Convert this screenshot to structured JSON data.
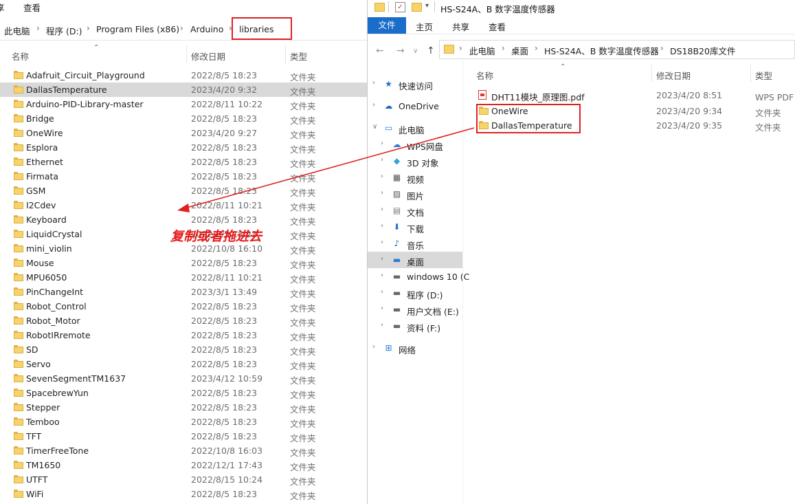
{
  "left": {
    "ribbon_tabs": [
      "享",
      "查看"
    ],
    "breadcrumb": [
      "此电脑",
      "程序 (D:)",
      "Program Files (x86)",
      "Arduino",
      "libraries"
    ],
    "columns": {
      "name": "名称",
      "date": "修改日期",
      "type": "类型"
    },
    "rows": [
      {
        "name": "Adafruit_Circuit_Playground",
        "date": "2022/8/5 18:23",
        "type": "文件夹"
      },
      {
        "name": "DallasTemperature",
        "date": "2023/4/20 9:32",
        "type": "文件夹"
      },
      {
        "name": "Arduino-PID-Library-master",
        "date": "2022/8/11 10:22",
        "type": "文件夹"
      },
      {
        "name": "Bridge",
        "date": "2022/8/5 18:23",
        "type": "文件夹"
      },
      {
        "name": "OneWire",
        "date": "2023/4/20 9:27",
        "type": "文件夹"
      },
      {
        "name": "Esplora",
        "date": "2022/8/5 18:23",
        "type": "文件夹"
      },
      {
        "name": "Ethernet",
        "date": "2022/8/5 18:23",
        "type": "文件夹"
      },
      {
        "name": "Firmata",
        "date": "2022/8/5 18:23",
        "type": "文件夹"
      },
      {
        "name": "GSM",
        "date": "2022/8/5 18:23",
        "type": "文件夹"
      },
      {
        "name": "I2Cdev",
        "date": "2022/8/11 10:21",
        "type": "文件夹"
      },
      {
        "name": "Keyboard",
        "date": "2022/8/5 18:23",
        "type": "文件夹"
      },
      {
        "name": "LiquidCrystal",
        "date": "2022/8/5 18:23",
        "type": "文件夹"
      },
      {
        "name": "mini_violin",
        "date": "2022/10/8 16:10",
        "type": "文件夹"
      },
      {
        "name": "Mouse",
        "date": "2022/8/5 18:23",
        "type": "文件夹"
      },
      {
        "name": "MPU6050",
        "date": "2022/8/11 10:21",
        "type": "文件夹"
      },
      {
        "name": "PinChangeInt",
        "date": "2023/3/1 13:49",
        "type": "文件夹"
      },
      {
        "name": "Robot_Control",
        "date": "2022/8/5 18:23",
        "type": "文件夹"
      },
      {
        "name": "Robot_Motor",
        "date": "2022/8/5 18:23",
        "type": "文件夹"
      },
      {
        "name": "RobotIRremote",
        "date": "2022/8/5 18:23",
        "type": "文件夹"
      },
      {
        "name": "SD",
        "date": "2022/8/5 18:23",
        "type": "文件夹"
      },
      {
        "name": "Servo",
        "date": "2022/8/5 18:23",
        "type": "文件夹"
      },
      {
        "name": "SevenSegmentTM1637",
        "date": "2023/4/12 10:59",
        "type": "文件夹"
      },
      {
        "name": "SpacebrewYun",
        "date": "2022/8/5 18:23",
        "type": "文件夹"
      },
      {
        "name": "Stepper",
        "date": "2022/8/5 18:23",
        "type": "文件夹"
      },
      {
        "name": "Temboo",
        "date": "2022/8/5 18:23",
        "type": "文件夹"
      },
      {
        "name": "TFT",
        "date": "2022/8/5 18:23",
        "type": "文件夹"
      },
      {
        "name": "TimerFreeTone",
        "date": "2022/10/8 16:03",
        "type": "文件夹"
      },
      {
        "name": "TM1650",
        "date": "2022/12/1 17:43",
        "type": "文件夹"
      },
      {
        "name": "UTFT",
        "date": "2022/8/15 10:24",
        "type": "文件夹"
      },
      {
        "name": "WiFi",
        "date": "2022/8/5 18:23",
        "type": "文件夹"
      }
    ],
    "selected_row": "DallasTemperature"
  },
  "right": {
    "title": "HS-S24A、B 数字温度传感器",
    "menu": [
      "文件",
      "主页",
      "共享",
      "查看"
    ],
    "breadcrumb": [
      "此电脑",
      "桌面",
      "HS-S24A、B 数字温度传感器",
      "DS18B20库文件"
    ],
    "nav": [
      {
        "label": "快速访问",
        "icon": "star-icon",
        "level": 0,
        "expand": "collapsed"
      },
      {
        "label": "OneDrive",
        "icon": "cloud-icon",
        "level": 0,
        "expand": "collapsed"
      },
      {
        "label": "此电脑",
        "icon": "computer-icon",
        "level": 0,
        "expand": "expanded"
      },
      {
        "label": "WPS网盘",
        "icon": "wps-cloud-icon",
        "level": 1,
        "expand": "collapsed"
      },
      {
        "label": "3D 对象",
        "icon": "cube-icon",
        "level": 1,
        "expand": "collapsed"
      },
      {
        "label": "视频",
        "icon": "video-icon",
        "level": 1,
        "expand": "collapsed"
      },
      {
        "label": "图片",
        "icon": "picture-icon",
        "level": 1,
        "expand": "collapsed"
      },
      {
        "label": "文档",
        "icon": "document-icon",
        "level": 1,
        "expand": "collapsed"
      },
      {
        "label": "下载",
        "icon": "download-icon",
        "level": 1,
        "expand": "collapsed"
      },
      {
        "label": "音乐",
        "icon": "music-icon",
        "level": 1,
        "expand": "collapsed"
      },
      {
        "label": "桌面",
        "icon": "desktop-icon",
        "level": 1,
        "expand": "collapsed"
      },
      {
        "label": "windows 10 (C",
        "icon": "drive-icon",
        "level": 1,
        "expand": "collapsed"
      },
      {
        "label": "程序 (D:)",
        "icon": "drive-icon",
        "level": 1,
        "expand": "collapsed"
      },
      {
        "label": "用户文档 (E:)",
        "icon": "drive-icon",
        "level": 1,
        "expand": "collapsed"
      },
      {
        "label": "资料 (F:)",
        "icon": "drive-icon",
        "level": 1,
        "expand": "collapsed"
      },
      {
        "label": "网络",
        "icon": "network-icon",
        "level": 0,
        "expand": "collapsed"
      }
    ],
    "nav_selected": "桌面",
    "columns": {
      "name": "名称",
      "date": "修改日期",
      "type": "类型"
    },
    "rows": [
      {
        "name": "DHT11模块_原理图.pdf",
        "date": "2023/4/20 8:51",
        "type": "WPS PDF 文",
        "icon": "pdf-icon"
      },
      {
        "name": "OneWire",
        "date": "2023/4/20 9:34",
        "type": "文件夹",
        "icon": "folder-icon"
      },
      {
        "name": "DallasTemperature",
        "date": "2023/4/20 9:35",
        "type": "文件夹",
        "icon": "folder-icon"
      }
    ]
  },
  "annotation": "复制或者拖进去",
  "colors": {
    "highlight": "#e02020",
    "accent": "#1a6dc8",
    "selected": "#d9d9d9"
  }
}
